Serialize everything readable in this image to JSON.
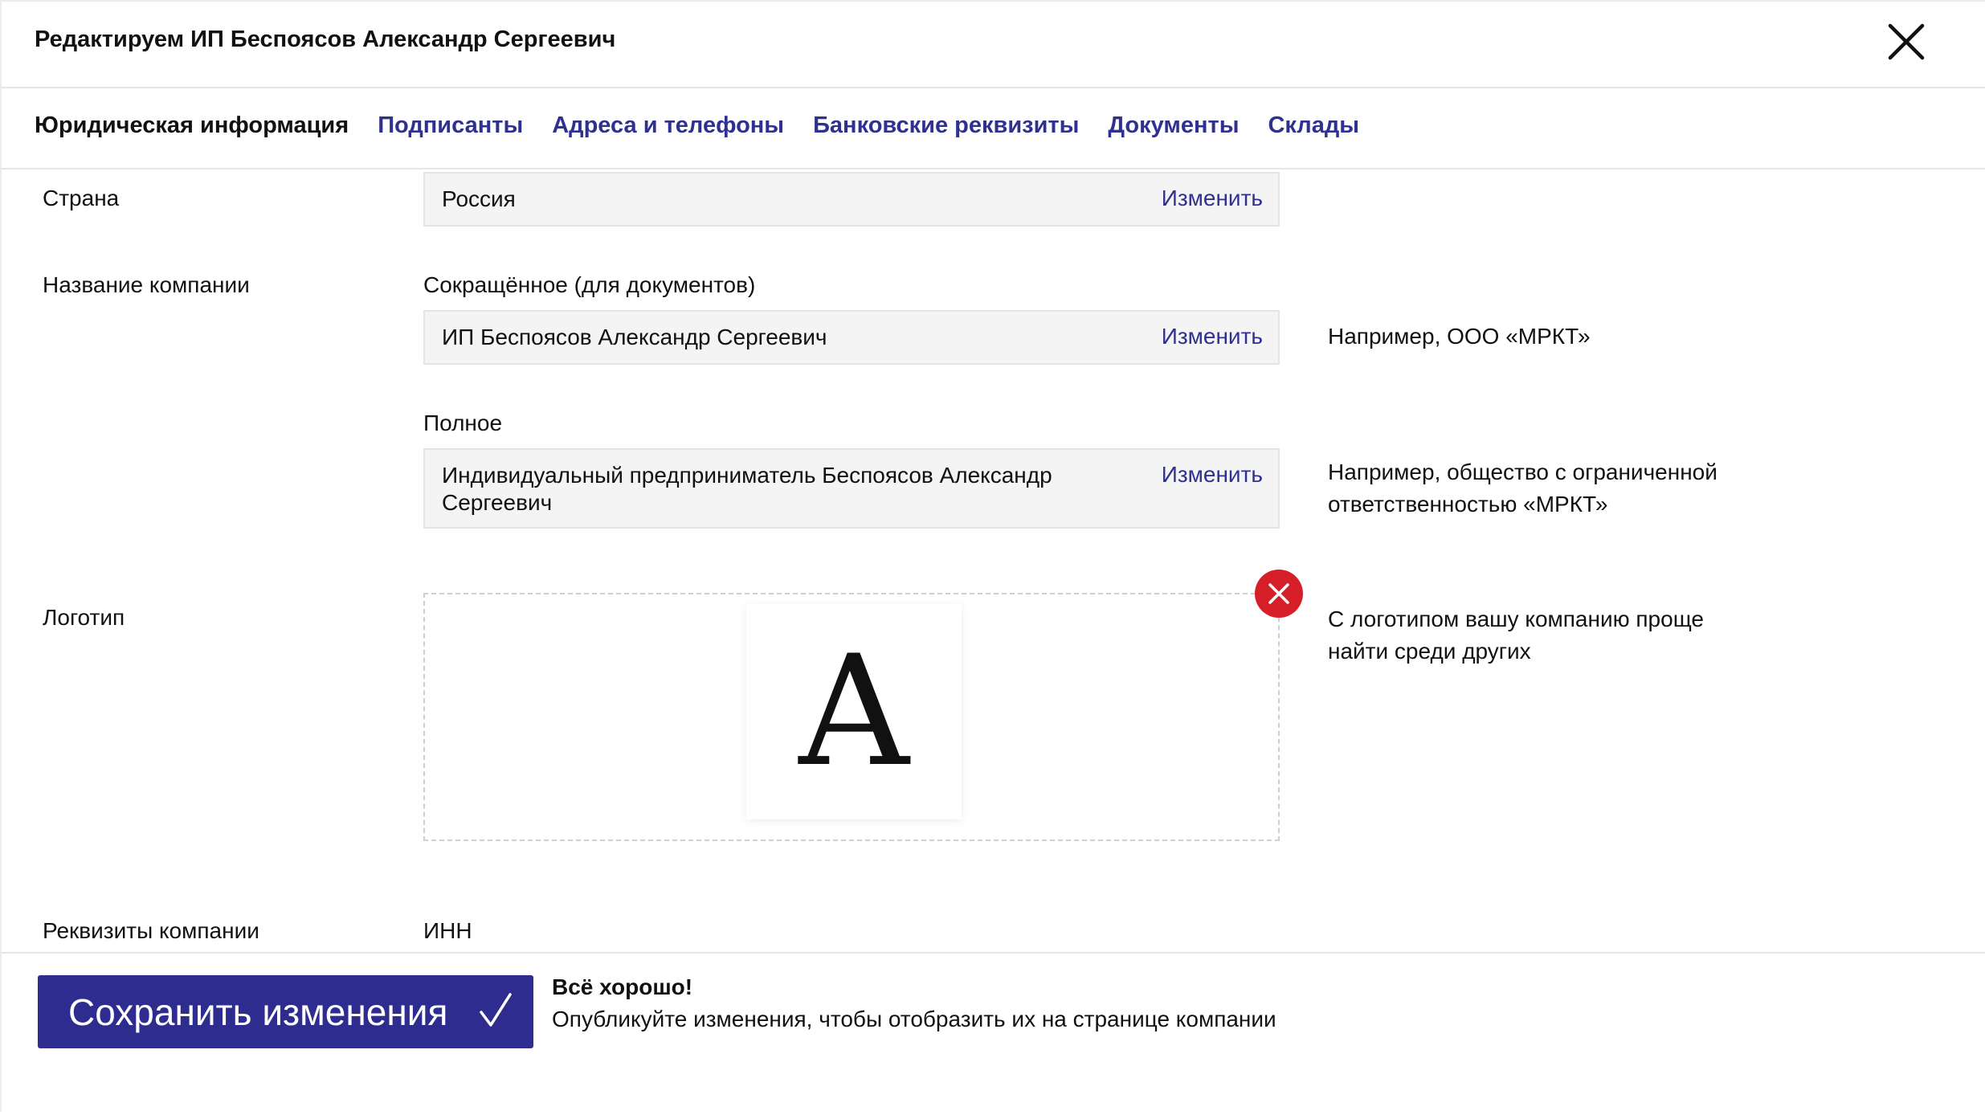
{
  "header": {
    "title": "Редактируем ИП Беспоясов Александр Сергеевич",
    "close_icon": "close-icon"
  },
  "tabs": [
    {
      "label": "Юридическая информация",
      "active": true
    },
    {
      "label": "Подписанты",
      "active": false
    },
    {
      "label": "Адреса и телефоны",
      "active": false
    },
    {
      "label": "Банковские реквизиты",
      "active": false
    },
    {
      "label": "Документы",
      "active": false
    },
    {
      "label": "Склады",
      "active": false
    }
  ],
  "country": {
    "label": "Страна",
    "value": "Россия",
    "change": "Изменить"
  },
  "company_name": {
    "label": "Название компании",
    "short": {
      "label": "Сокращённое (для документов)",
      "value": "ИП Беспоясов Александр Сергеевич",
      "change": "Изменить",
      "hint": "Например, ООО «МРКТ»"
    },
    "full": {
      "label": "Полное",
      "value": "Индивидуальный предприниматель Беспоясов Александр Сергеевич",
      "change": "Изменить",
      "hint": "Например, общество с ограниченной ответственностью «МРКТ»"
    }
  },
  "logo": {
    "label": "Логотип",
    "letter": "A",
    "hint": "С логотипом вашу компанию проще найти среди других",
    "remove_icon": "remove-icon"
  },
  "requisites": {
    "label": "Реквизиты компании",
    "inn_label": "ИНН"
  },
  "footer": {
    "save_label": "Сохранить изменения",
    "status_title": "Всё хорошо!",
    "status_text": "Опубликуйте изменения, чтобы отобразить их на странице компании"
  },
  "colors": {
    "accent": "#2f3190",
    "button": "#2f2c8f",
    "remove": "#d71f2a"
  }
}
